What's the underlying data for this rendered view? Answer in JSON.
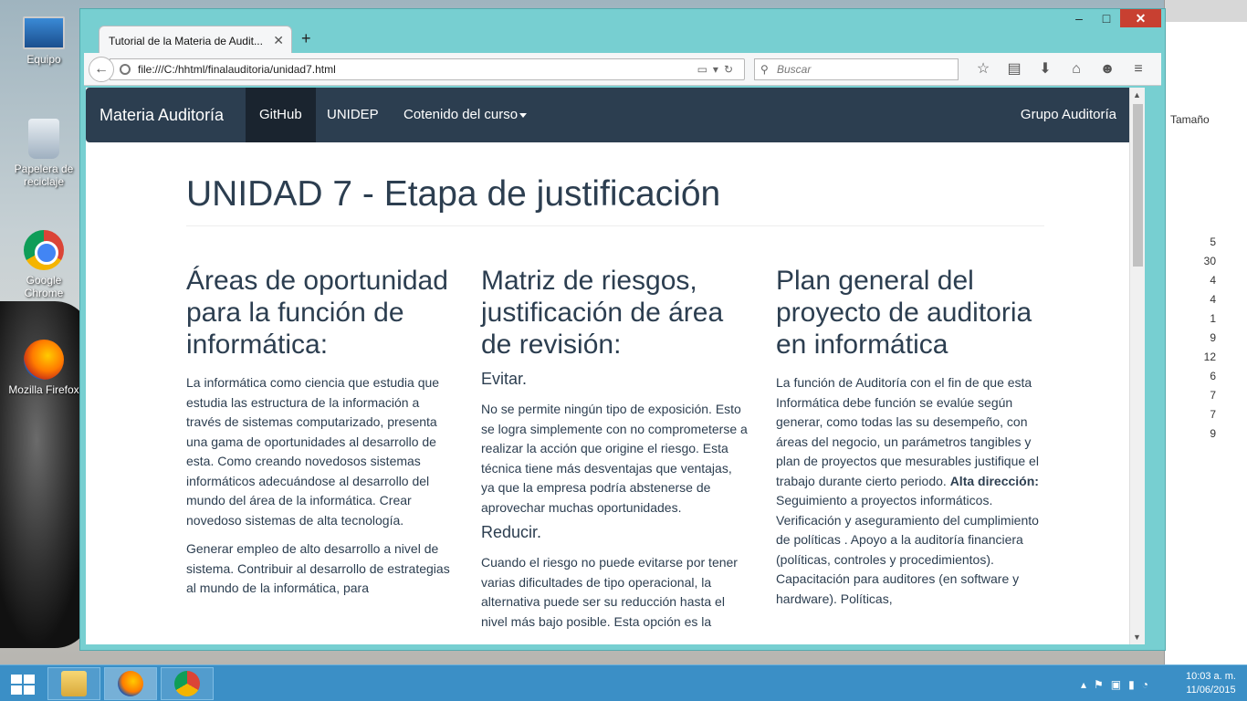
{
  "desktop": {
    "icons": [
      {
        "label": "Equipo"
      },
      {
        "label": "Papelera de reciclaje"
      },
      {
        "label": "Google Chrome"
      },
      {
        "label": "Mozilla Firefox"
      }
    ]
  },
  "background_window": {
    "label": "Tamaño",
    "numbers": [
      "5",
      "30",
      "4",
      "4",
      "1",
      "9",
      "12",
      "6",
      "7",
      "7",
      "9"
    ]
  },
  "browser": {
    "tab_title": "Tutorial de la Materia de Audit...",
    "url": "file:///C:/hhtml/finalauditoria/unidad7.html",
    "search_placeholder": "Buscar"
  },
  "navbar": {
    "brand": "Materia Auditoría",
    "items": [
      "GitHub",
      "UNIDEP",
      "Cotenido del curso"
    ],
    "right_item": "Grupo Auditoría"
  },
  "page": {
    "title": "UNIDAD 7 - Etapa de justificación",
    "col1": {
      "heading": "Áreas de oportunidad para la función de informática:",
      "p1": "La informática  como ciencia que estudia que estudia las estructura de la información a través de sistemas computarizado, presenta una gama de oportunidades al desarrollo de esta. Como creando novedosos sistemas informáticos adecuándose al desarrollo del mundo del área de la informática. Crear novedoso sistemas de alta tecnología.",
      "p2": "Generar empleo de alto desarrollo a nivel de sistema. Contribuir al desarrollo de estrategias al mundo de la informática, para"
    },
    "col2": {
      "heading": "Matriz de riesgos, justificación de área de revisión:",
      "sub1": "Evitar.",
      "p1": "No se permite ningún tipo de exposición. Esto se logra simplemente con no comprometerse a realizar la acción que origine el riesgo. Esta técnica tiene más desventajas que ventajas, ya que la empresa podría abstenerse de aprovechar muchas oportunidades.",
      "sub2": "Reducir.",
      "p2": "Cuando el riesgo no puede evitarse por tener varias dificultades de tipo operacional, la alternativa puede ser su reducción hasta el nivel más bajo posible. Esta opción es la"
    },
    "col3": {
      "heading": "Plan general del proyecto de auditoria en informática",
      "p1_start": "La función de Auditoría con el fin de que esta Informática debe función se evalúe según generar, como todas las su desempeño, con áreas del negocio, un parámetros tangibles y plan de proyectos que mesurables justifique el trabajo durante cierto periodo.",
      "p1_bold": "Alta dirección:",
      "p1_end": "Seguimiento a proyectos informáticos. Verificación y aseguramiento del cumplimiento de políticas . Apoyo a la auditoría financiera (políticas, controles y procedimientos). Capacitación para auditores (en software y hardware). Políticas,"
    }
  },
  "taskbar": {
    "time": "10:03 a. m.",
    "date": "11/06/2015"
  }
}
